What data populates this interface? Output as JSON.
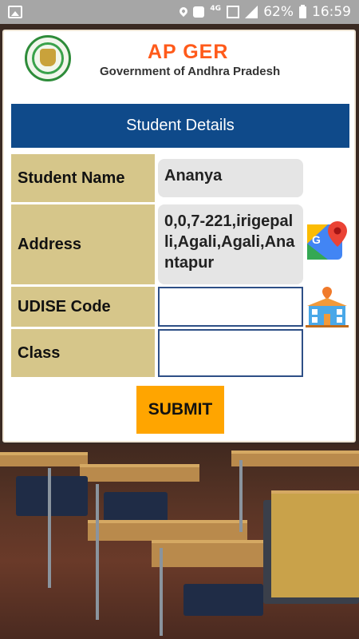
{
  "status_bar": {
    "network": "4G",
    "battery": "62%",
    "time": "16:59"
  },
  "header": {
    "title": "AP GER",
    "subtitle": "Government of Andhra Pradesh"
  },
  "section": {
    "title": "Student Details"
  },
  "form": {
    "student_name": {
      "label": "Student Name",
      "value": "Ananya"
    },
    "address": {
      "label": "Address",
      "value": "0,0,7-221,irigepalli,Agali,Agali,Anantapur"
    },
    "udise_code": {
      "label": "UDISE Code",
      "value": ""
    },
    "class": {
      "label": "Class",
      "value": ""
    }
  },
  "actions": {
    "submit_label": "SUBMIT"
  },
  "colors": {
    "status_bar": "#a6a6a6",
    "title_orange": "#ff5a1a",
    "section_blue": "#0f4a8a",
    "label_tan": "#d6c68a",
    "submit_orange": "#ffa500"
  },
  "icons": [
    "gallery-icon",
    "location-icon",
    "notification-icon",
    "signal-icon",
    "battery-icon",
    "emblem-logo",
    "maps-icon",
    "school-icon"
  ]
}
